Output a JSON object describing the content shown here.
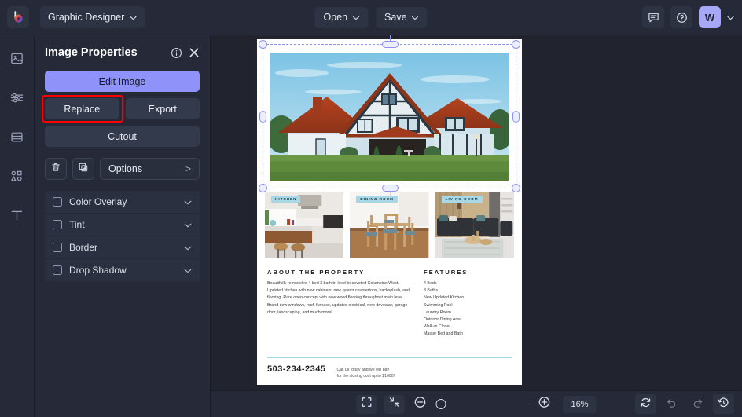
{
  "header": {
    "logo": "befunky-logo-icon",
    "project_label": "Graphic Designer",
    "open_label": "Open",
    "save_label": "Save",
    "comment_icon": "comment-icon",
    "help_icon": "help-icon",
    "avatar_initial": "W",
    "avatar_color": "#a6a8f7"
  },
  "rail": {
    "items": [
      {
        "name": "image-tool",
        "icon": "image-icon"
      },
      {
        "name": "adjust-tool",
        "icon": "sliders-icon"
      },
      {
        "name": "layout-tool",
        "icon": "layout-icon"
      },
      {
        "name": "shapes-tool",
        "icon": "shapes-icon"
      },
      {
        "name": "text-tool",
        "icon": "text-icon"
      }
    ]
  },
  "panel": {
    "title": "Image Properties",
    "info_icon": "info-icon",
    "close_icon": "close-icon",
    "edit_image_label": "Edit Image",
    "replace_label": "Replace",
    "export_label": "Export",
    "cutout_label": "Cutout",
    "delete_icon": "trash-icon",
    "duplicate_icon": "duplicate-icon",
    "options_label": "Options",
    "options_arrow": ">",
    "highlight_color": "#ff0000",
    "effects": [
      {
        "label": "Color Overlay",
        "checked": false
      },
      {
        "label": "Tint",
        "checked": false
      },
      {
        "label": "Border",
        "checked": false
      },
      {
        "label": "Drop Shadow",
        "checked": false
      }
    ]
  },
  "document": {
    "thumbnails": [
      {
        "label": "KITCHEN"
      },
      {
        "label": "DINING ROOM"
      },
      {
        "label": "LIVING ROOM"
      }
    ],
    "about_heading": "ABOUT THE PROPERTY",
    "about_body": "Beautifully remodeled 4 bed 3 bath tri-level in coveted Columbine West. Updated kitchen with new cabinets, new quartz countertops, backsplash, and flooring. Rare open concept with new wood flooring throughout main level. Brand new windows, roof, furnace, updated electrical, new driveway, garage door, landscaping, and much more!",
    "features_heading": "FEATURES",
    "features": [
      "4 Beds",
      "3 Baths",
      "New Updated Kitchen",
      "Swimming Pool",
      "Laundry Room",
      "Outdoor Dining Area",
      "Walk-in Closet",
      "Master Bed and Bath"
    ],
    "phone": "503-234-2345",
    "cta_line1": "Call us today and we will pay",
    "cta_line2": "for the closing cost up to $1000!",
    "accent_color": "#a8d8e6"
  },
  "bottom": {
    "fit_icon": "fit-screen-icon",
    "shrink_icon": "shrink-icon",
    "zoom_out_icon": "zoom-out-icon",
    "zoom_in_icon": "zoom-in-icon",
    "zoom_value": "16%",
    "refresh_icon": "refresh-icon",
    "undo_icon": "undo-icon",
    "redo_icon": "redo-icon",
    "history_icon": "history-icon"
  }
}
